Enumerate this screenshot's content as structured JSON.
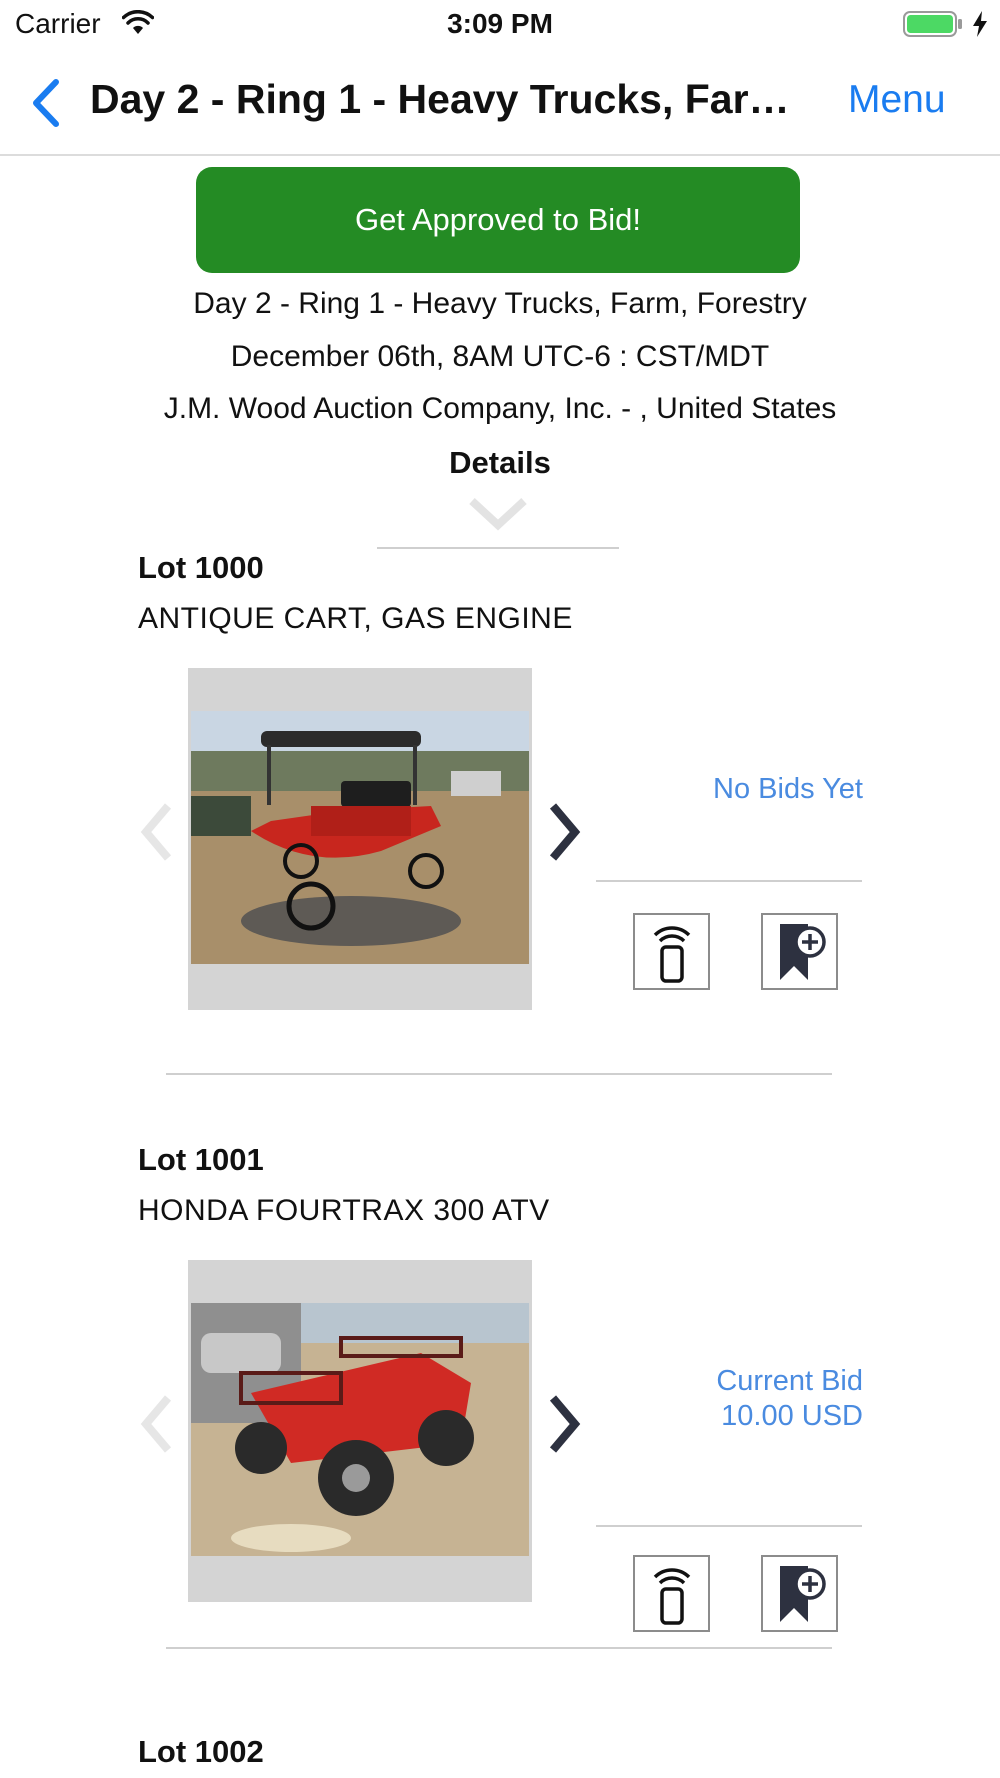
{
  "status_bar": {
    "carrier": "Carrier",
    "time": "3:09 PM"
  },
  "nav": {
    "title": "Day 2 - Ring 1 - Heavy Trucks, Farm,...",
    "menu_label": "Menu",
    "accent_color": "#1a7cf0"
  },
  "approve_button": {
    "label": "Get Approved to Bid!",
    "color": "#248b24"
  },
  "auction": {
    "name": "Day 2 - Ring 1 - Heavy Trucks, Farm, Forestry",
    "date": "December 06th, 8AM UTC-6 : CST/MDT",
    "company": "J.M. Wood Auction Company, Inc. - , United States",
    "details_label": "Details"
  },
  "lots": [
    {
      "number": "Lot 1000",
      "title": "ANTIQUE CART, GAS ENGINE",
      "bid_status": "No Bids Yet",
      "bid_amount": "",
      "photo_subject": "red antique motor cart"
    },
    {
      "number": "Lot 1001",
      "title": "HONDA FOURTRAX 300 ATV",
      "bid_status": "Current Bid",
      "bid_amount": "10.00 USD",
      "photo_subject": "red ATV"
    },
    {
      "number": "Lot 1002"
    }
  ],
  "icons": {
    "live_bid": "phone-signal-icon",
    "watchlist": "bookmark-add-icon",
    "prev": "chevron-left-icon",
    "next": "chevron-right-icon"
  },
  "colors": {
    "bid_text": "#4a8be0",
    "divider": "#cfcfcf"
  }
}
